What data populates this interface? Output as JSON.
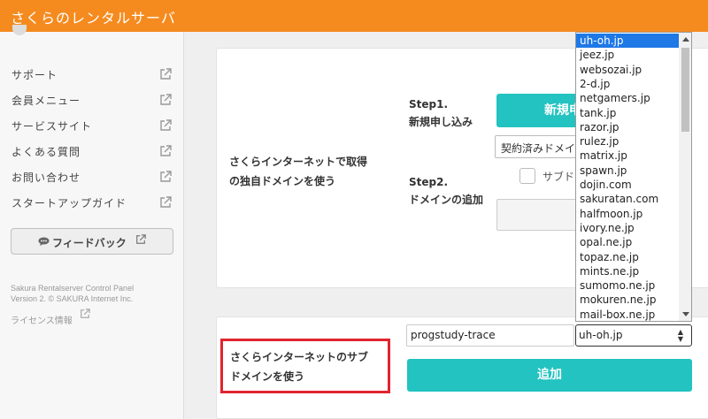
{
  "header": {
    "title": "さくらのレンタルサーバ"
  },
  "sidebar": {
    "items": [
      {
        "label": "サポート",
        "icon": "external-link-icon"
      },
      {
        "label": "会員メニュー",
        "icon": "external-link-icon"
      },
      {
        "label": "サービスサイト",
        "icon": "external-link-icon"
      },
      {
        "label": "よくある質問",
        "icon": "external-link-icon"
      },
      {
        "label": "お問い合わせ",
        "icon": "external-link-icon"
      },
      {
        "label": "スタートアップガイド",
        "icon": "external-link-icon"
      }
    ],
    "feedback_label": "フィードバック",
    "footer_line1": "Sakura Rentalserver Control Panel",
    "footer_line2": "Version 2. © SAKURA Internet Inc.",
    "license_label": "ライセンス情報"
  },
  "own_domain": {
    "label_line1": "さくらインターネットで取得",
    "label_line2": "の独自ドメインを使う",
    "step1_line1": "Step1.",
    "step1_line2": "新規申し込み",
    "new_button": "新規申",
    "contract_select": "契約済みドメイン",
    "step2_line1": "Step2.",
    "step2_line2": "ドメインの追加",
    "subdomain_checkbox_label": "サブド"
  },
  "subdomain": {
    "label_line1": "さくらインターネットのサブ",
    "label_line2": "ドメインを使う",
    "input_value": "progstudy-trace",
    "selected_domain": "uh-oh.jp",
    "add_button": "追加"
  },
  "dropdown": {
    "options": [
      "uh-oh.jp",
      "jeez.jp",
      "websozai.jp",
      "2-d.jp",
      "netgamers.jp",
      "tank.jp",
      "razor.jp",
      "rulez.jp",
      "matrix.jp",
      "spawn.jp",
      "dojin.com",
      "sakuratan.com",
      "halfmoon.jp",
      "ivory.ne.jp",
      "opal.ne.jp",
      "topaz.ne.jp",
      "mints.ne.jp",
      "sumomo.ne.jp",
      "mokuren.ne.jp",
      "mail-box.ne.jp"
    ],
    "selected_index": 0
  },
  "colors": {
    "header": "#f58b1f",
    "accent": "#22c3c0",
    "highlight_border": "#e0242f",
    "selection": "#1e78e6"
  }
}
